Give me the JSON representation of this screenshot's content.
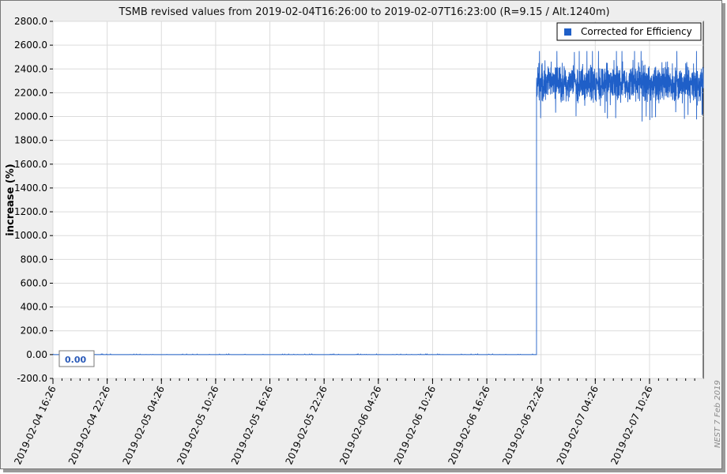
{
  "chart_data": {
    "type": "line",
    "title": "TSMB revised values from 2019-02-04T16:26:00 to 2019-02-07T16:23:00 (R=9.15 / Alt.1240m)",
    "ylabel": "increase (%)",
    "xlabel": "",
    "ylim": [
      -200,
      2800
    ],
    "xlim": [
      "2019-02-04 16:26",
      "2019-02-07 16:23"
    ],
    "y_ticks": [
      "-200.0",
      "0.00",
      "200.0",
      "400.0",
      "600.0",
      "800.0",
      "1000.0",
      "1200.0",
      "1400.0",
      "1600.0",
      "1800.0",
      "2000.0",
      "2200.0",
      "2400.0",
      "2600.0",
      "2800.0"
    ],
    "x_ticks": [
      "2019-02-04 16:26",
      "2019-02-04 22:26",
      "2019-02-05 04:26",
      "2019-02-05 10:26",
      "2019-02-05 16:26",
      "2019-02-05 22:26",
      "2019-02-06 04:26",
      "2019-02-06 10:26",
      "2019-02-06 16:26",
      "2019-02-06 22:26",
      "2019-02-07 04:26",
      "2019-02-07 10:26"
    ],
    "grid": true,
    "legend_position": "top-right",
    "series": [
      {
        "name": "Corrected for Efficiency",
        "color": "#1f5fc8",
        "segments": [
          {
            "x_start": "2019-02-04 16:26",
            "x_end": "2019-02-06 21:56",
            "mean": 0,
            "spread": 6
          },
          {
            "x_start": "2019-02-06 21:56",
            "x_end": "2019-02-07 16:23",
            "mean": 2280,
            "spread": 110,
            "min": 1910,
            "max": 2550
          }
        ]
      }
    ],
    "annotation": "0.00",
    "credit": "NEST  7 Feb 2019"
  }
}
